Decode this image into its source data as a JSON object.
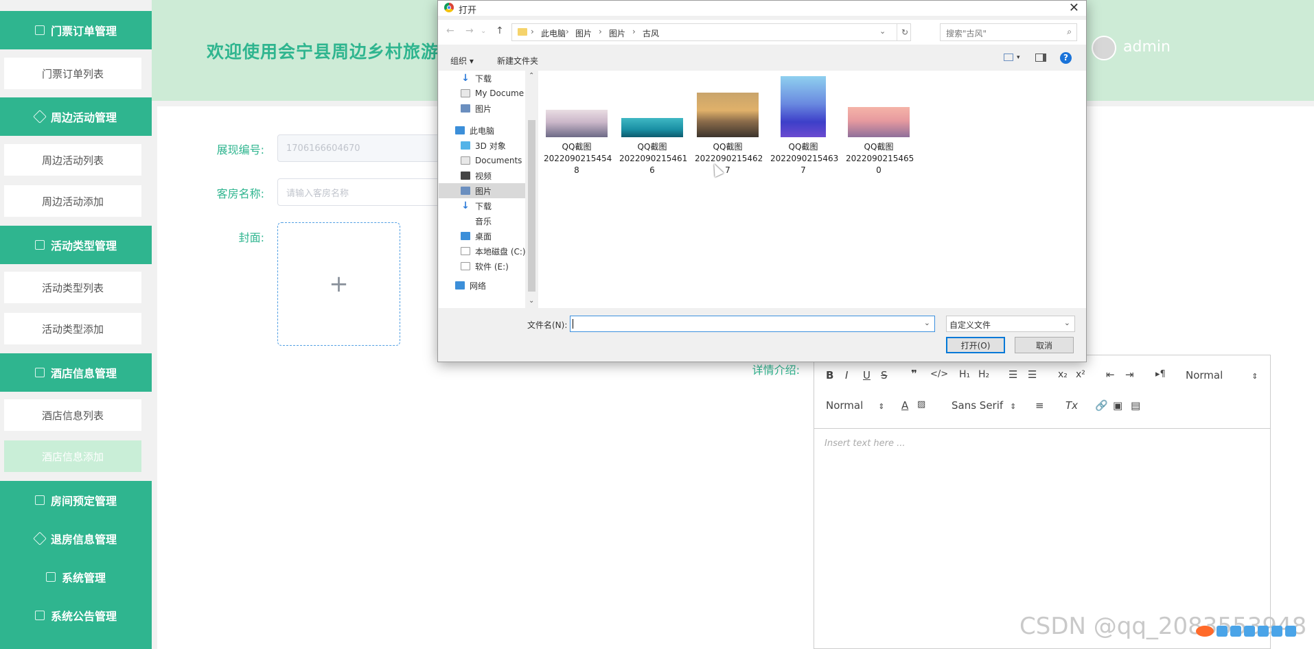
{
  "header": {
    "title": "欢迎使用会宁县周边乡村旅游",
    "user": "admin"
  },
  "sidebar": {
    "groups": [
      {
        "label": "门票订单管理",
        "icon": "edit-icon"
      },
      {
        "label": "周边活动管理",
        "icon": "diamond-icon"
      },
      {
        "label": "活动类型管理",
        "icon": "chart-icon"
      },
      {
        "label": "酒店信息管理",
        "icon": "document-icon"
      },
      {
        "label": "房间预定管理",
        "icon": "edit-icon"
      },
      {
        "label": "退房信息管理",
        "icon": "diamond-icon"
      },
      {
        "label": "系统管理",
        "icon": "edit-icon"
      },
      {
        "label": "系统公告管理",
        "icon": "document-icon"
      }
    ],
    "items": [
      {
        "label": "门票订单列表"
      },
      {
        "label": "周边活动列表"
      },
      {
        "label": "周边活动添加"
      },
      {
        "label": "活动类型列表"
      },
      {
        "label": "活动类型添加"
      },
      {
        "label": "酒店信息列表"
      },
      {
        "label": "酒店信息添加",
        "active": true
      }
    ]
  },
  "form": {
    "code_label": "展现编号:",
    "code_value": "1706166604670",
    "room_label": "客房名称:",
    "room_placeholder": "请输入客房名称",
    "cover_label": "封面:",
    "detail_label": "详情介绍:",
    "uploader_plus": "+"
  },
  "editor": {
    "header_select": "Normal",
    "size_select": "Normal",
    "font_select": "Sans Serif",
    "placeholder": "Insert text here ..."
  },
  "dialog": {
    "title": "打开",
    "close": "✕",
    "breadcrumbs": [
      "此电脑",
      "图片",
      "图片",
      "古风"
    ],
    "search_placeholder": "搜索\"古风\"",
    "organize": "组织 ▾",
    "new_folder": "新建文件夹",
    "nav_items": [
      {
        "label": "下载",
        "icon": "download-icon",
        "pinned": true
      },
      {
        "label": "My Docume",
        "icon": "document-icon",
        "pinned": true
      },
      {
        "label": "图片",
        "icon": "pictures-icon",
        "pinned": true
      },
      {
        "label": "此电脑",
        "icon": "computer-icon"
      },
      {
        "label": "3D 对象",
        "icon": "cube-icon"
      },
      {
        "label": "Documents",
        "icon": "document-icon"
      },
      {
        "label": "视频",
        "icon": "video-icon"
      },
      {
        "label": "图片",
        "icon": "pictures-icon",
        "selected": true
      },
      {
        "label": "下载",
        "icon": "download-icon"
      },
      {
        "label": "音乐",
        "icon": "music-icon"
      },
      {
        "label": "桌面",
        "icon": "desktop-icon"
      },
      {
        "label": "本地磁盘 (C:)",
        "icon": "drive-icon"
      },
      {
        "label": "软件 (E:)",
        "icon": "drive-icon"
      },
      {
        "label": "网络",
        "icon": "network-icon"
      }
    ],
    "files": [
      {
        "line1": "QQ截图",
        "line2": "2022090215454",
        "line3": "8"
      },
      {
        "line1": "QQ截图",
        "line2": "2022090215461",
        "line3": "6"
      },
      {
        "line1": "QQ截图",
        "line2": "2022090215462",
        "line3": "7"
      },
      {
        "line1": "QQ截图",
        "line2": "2022090215463",
        "line3": "7"
      },
      {
        "line1": "QQ截图",
        "line2": "2022090215465",
        "line3": "0"
      }
    ],
    "filename_label": "文件名(N):",
    "filename_value": "",
    "file_type": "自定义文件",
    "open_button": "打开(O)",
    "cancel_button": "取消"
  },
  "watermark": "CSDN @qq_2083553948"
}
